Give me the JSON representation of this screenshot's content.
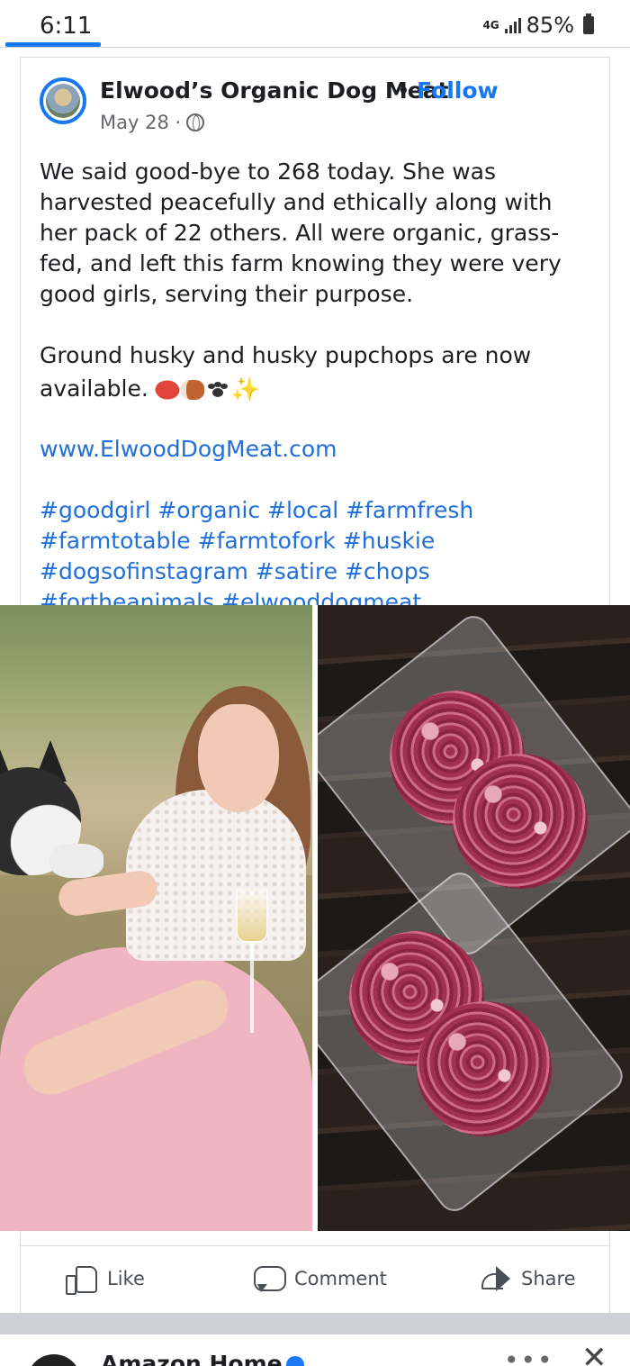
{
  "status_bar": {
    "time": "6:11",
    "network": "4G",
    "battery": "85%"
  },
  "post": {
    "page_name": "Elwood’s Organic Dog Meat",
    "separator": "•",
    "follow_label": "Follow",
    "date": "May 28 ·",
    "paragraph1": "We said good-bye to 268 today. She was harvested peacefully and ethically along with her pack of 22 others. All were organic, grass-fed, and left this farm knowing they were very good girls, serving their purpose.",
    "paragraph2": "Ground husky and husky pupchops are now available.",
    "sparkle": "✨",
    "link": "www.ElwoodDogMeat.com",
    "hashtags": "#goodgirl #organic #local #farmfresh #farmtotable #farmtofork #huskie #dogsofinstagram #satire #chops #fortheanimals #elwooddogmeat"
  },
  "actions": {
    "like": "Like",
    "comment": "Comment",
    "share": "Share"
  },
  "next_post": {
    "name": "Amazon Home",
    "more": "•••",
    "close": "✕"
  },
  "colors": {
    "facebook_blue": "#1877f2",
    "link_blue": "#216fdb"
  }
}
